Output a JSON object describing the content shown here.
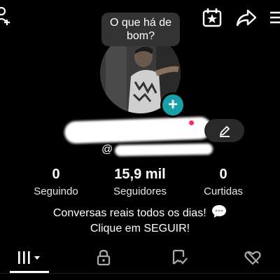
{
  "header": {
    "icons": [
      "add-user-icon",
      "calendar-star-icon",
      "share-icon",
      "menu-icon"
    ]
  },
  "bubble": {
    "text": "O que há de bom?"
  },
  "profile": {
    "handle_prefix": "@",
    "accent_color": "#19a0a7",
    "notification_color": "#fe2c55"
  },
  "stats": {
    "following": {
      "value": "0",
      "label": "Seguindo"
    },
    "followers": {
      "value": "15,9 mil",
      "label": "Seguidores"
    },
    "likes": {
      "value": "0",
      "label": "Curtidas"
    }
  },
  "bio": {
    "line1": "Conversas reais todos os dias!",
    "line2": "Clique em SEGUIR!"
  },
  "tabs": [
    {
      "icon": "grid-icon",
      "active": true
    },
    {
      "icon": "lock-icon",
      "active": false
    },
    {
      "icon": "repost-icon",
      "active": false
    },
    {
      "icon": "liked-icon",
      "active": false
    }
  ]
}
